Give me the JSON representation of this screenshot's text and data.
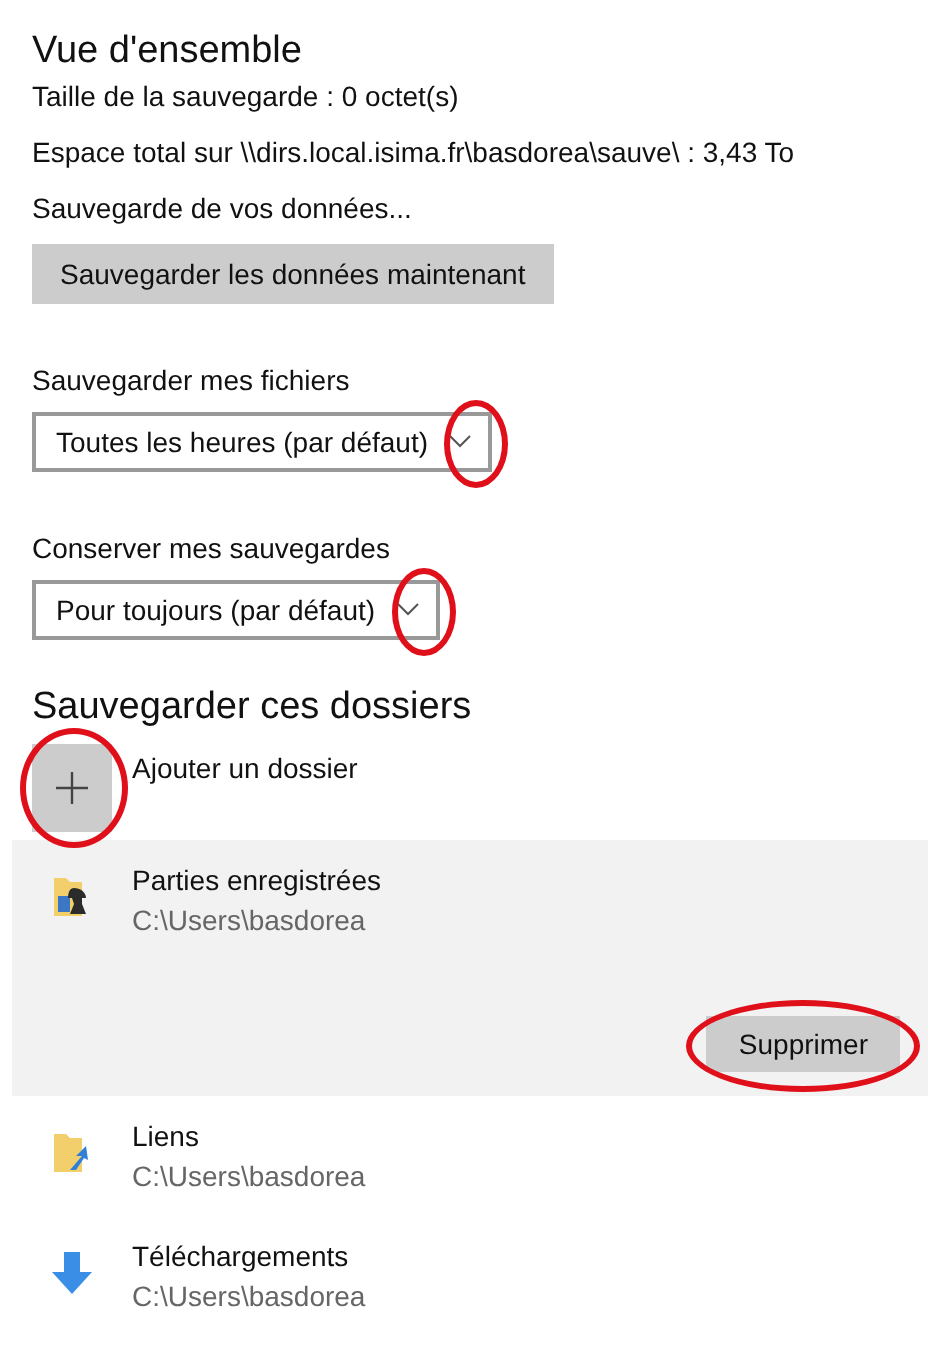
{
  "overview": {
    "title": "Vue d'ensemble",
    "lines": [
      "Taille de la sauvegarde : 0 octet(s)",
      "Espace total sur \\\\dirs.local.isima.fr\\basdorea\\sauve\\ : 3,43 To",
      "Sauvegarde de vos données..."
    ],
    "button": "Sauvegarder les données maintenant"
  },
  "settings": [
    {
      "label": "Sauvegarder mes fichiers",
      "value": "Toutes les heures (par défaut)",
      "highlighted": true
    },
    {
      "label": "Conserver mes sauvegardes",
      "value": "Pour toujours (par défaut)",
      "highlighted": true
    }
  ],
  "folders_section": {
    "title": "Sauvegarder ces dossiers",
    "add_label": "Ajouter un dossier",
    "add_highlighted": true,
    "folders": [
      {
        "kind": "saved-games",
        "name": "Parties enregistrées",
        "path": "C:\\Users\\basdorea",
        "selected": true,
        "action": "Supprimer",
        "action_highlighted": true
      },
      {
        "kind": "links",
        "name": "Liens",
        "path": "C:\\Users\\basdorea",
        "selected": false
      },
      {
        "kind": "downloads",
        "name": "Téléchargements",
        "path": "C:\\Users\\basdorea",
        "selected": false
      }
    ]
  }
}
